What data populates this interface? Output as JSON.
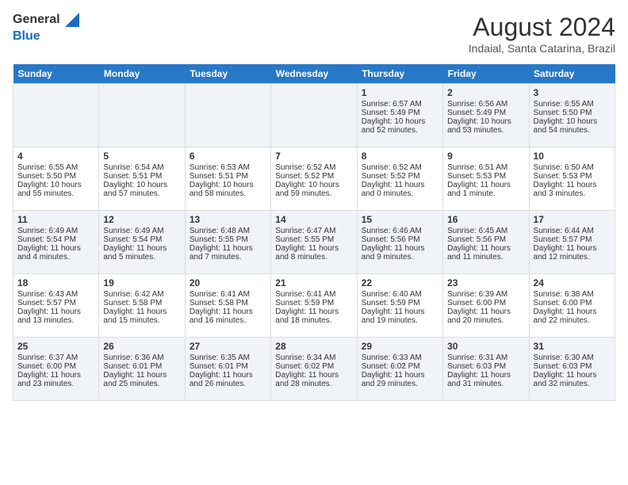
{
  "logo": {
    "general": "General",
    "blue": "Blue",
    "icon": "▶"
  },
  "title": "August 2024",
  "subtitle": "Indaial, Santa Catarina, Brazil",
  "headers": [
    "Sunday",
    "Monday",
    "Tuesday",
    "Wednesday",
    "Thursday",
    "Friday",
    "Saturday"
  ],
  "weeks": [
    [
      {
        "day": "",
        "sunrise": "",
        "sunset": "",
        "daylight": ""
      },
      {
        "day": "",
        "sunrise": "",
        "sunset": "",
        "daylight": ""
      },
      {
        "day": "",
        "sunrise": "",
        "sunset": "",
        "daylight": ""
      },
      {
        "day": "",
        "sunrise": "",
        "sunset": "",
        "daylight": ""
      },
      {
        "day": "1",
        "sunrise": "Sunrise: 6:57 AM",
        "sunset": "Sunset: 5:49 PM",
        "daylight": "Daylight: 10 hours and 52 minutes."
      },
      {
        "day": "2",
        "sunrise": "Sunrise: 6:56 AM",
        "sunset": "Sunset: 5:49 PM",
        "daylight": "Daylight: 10 hours and 53 minutes."
      },
      {
        "day": "3",
        "sunrise": "Sunrise: 6:55 AM",
        "sunset": "Sunset: 5:50 PM",
        "daylight": "Daylight: 10 hours and 54 minutes."
      }
    ],
    [
      {
        "day": "4",
        "sunrise": "Sunrise: 6:55 AM",
        "sunset": "Sunset: 5:50 PM",
        "daylight": "Daylight: 10 hours and 55 minutes."
      },
      {
        "day": "5",
        "sunrise": "Sunrise: 6:54 AM",
        "sunset": "Sunset: 5:51 PM",
        "daylight": "Daylight: 10 hours and 57 minutes."
      },
      {
        "day": "6",
        "sunrise": "Sunrise: 6:53 AM",
        "sunset": "Sunset: 5:51 PM",
        "daylight": "Daylight: 10 hours and 58 minutes."
      },
      {
        "day": "7",
        "sunrise": "Sunrise: 6:52 AM",
        "sunset": "Sunset: 5:52 PM",
        "daylight": "Daylight: 10 hours and 59 minutes."
      },
      {
        "day": "8",
        "sunrise": "Sunrise: 6:52 AM",
        "sunset": "Sunset: 5:52 PM",
        "daylight": "Daylight: 11 hours and 0 minutes."
      },
      {
        "day": "9",
        "sunrise": "Sunrise: 6:51 AM",
        "sunset": "Sunset: 5:53 PM",
        "daylight": "Daylight: 11 hours and 1 minute."
      },
      {
        "day": "10",
        "sunrise": "Sunrise: 6:50 AM",
        "sunset": "Sunset: 5:53 PM",
        "daylight": "Daylight: 11 hours and 3 minutes."
      }
    ],
    [
      {
        "day": "11",
        "sunrise": "Sunrise: 6:49 AM",
        "sunset": "Sunset: 5:54 PM",
        "daylight": "Daylight: 11 hours and 4 minutes."
      },
      {
        "day": "12",
        "sunrise": "Sunrise: 6:49 AM",
        "sunset": "Sunset: 5:54 PM",
        "daylight": "Daylight: 11 hours and 5 minutes."
      },
      {
        "day": "13",
        "sunrise": "Sunrise: 6:48 AM",
        "sunset": "Sunset: 5:55 PM",
        "daylight": "Daylight: 11 hours and 7 minutes."
      },
      {
        "day": "14",
        "sunrise": "Sunrise: 6:47 AM",
        "sunset": "Sunset: 5:55 PM",
        "daylight": "Daylight: 11 hours and 8 minutes."
      },
      {
        "day": "15",
        "sunrise": "Sunrise: 6:46 AM",
        "sunset": "Sunset: 5:56 PM",
        "daylight": "Daylight: 11 hours and 9 minutes."
      },
      {
        "day": "16",
        "sunrise": "Sunrise: 6:45 AM",
        "sunset": "Sunset: 5:56 PM",
        "daylight": "Daylight: 11 hours and 11 minutes."
      },
      {
        "day": "17",
        "sunrise": "Sunrise: 6:44 AM",
        "sunset": "Sunset: 5:57 PM",
        "daylight": "Daylight: 11 hours and 12 minutes."
      }
    ],
    [
      {
        "day": "18",
        "sunrise": "Sunrise: 6:43 AM",
        "sunset": "Sunset: 5:57 PM",
        "daylight": "Daylight: 11 hours and 13 minutes."
      },
      {
        "day": "19",
        "sunrise": "Sunrise: 6:42 AM",
        "sunset": "Sunset: 5:58 PM",
        "daylight": "Daylight: 11 hours and 15 minutes."
      },
      {
        "day": "20",
        "sunrise": "Sunrise: 6:41 AM",
        "sunset": "Sunset: 5:58 PM",
        "daylight": "Daylight: 11 hours and 16 minutes."
      },
      {
        "day": "21",
        "sunrise": "Sunrise: 6:41 AM",
        "sunset": "Sunset: 5:59 PM",
        "daylight": "Daylight: 11 hours and 18 minutes."
      },
      {
        "day": "22",
        "sunrise": "Sunrise: 6:40 AM",
        "sunset": "Sunset: 5:59 PM",
        "daylight": "Daylight: 11 hours and 19 minutes."
      },
      {
        "day": "23",
        "sunrise": "Sunrise: 6:39 AM",
        "sunset": "Sunset: 6:00 PM",
        "daylight": "Daylight: 11 hours and 20 minutes."
      },
      {
        "day": "24",
        "sunrise": "Sunrise: 6:38 AM",
        "sunset": "Sunset: 6:00 PM",
        "daylight": "Daylight: 11 hours and 22 minutes."
      }
    ],
    [
      {
        "day": "25",
        "sunrise": "Sunrise: 6:37 AM",
        "sunset": "Sunset: 6:00 PM",
        "daylight": "Daylight: 11 hours and 23 minutes."
      },
      {
        "day": "26",
        "sunrise": "Sunrise: 6:36 AM",
        "sunset": "Sunset: 6:01 PM",
        "daylight": "Daylight: 11 hours and 25 minutes."
      },
      {
        "day": "27",
        "sunrise": "Sunrise: 6:35 AM",
        "sunset": "Sunset: 6:01 PM",
        "daylight": "Daylight: 11 hours and 26 minutes."
      },
      {
        "day": "28",
        "sunrise": "Sunrise: 6:34 AM",
        "sunset": "Sunset: 6:02 PM",
        "daylight": "Daylight: 11 hours and 28 minutes."
      },
      {
        "day": "29",
        "sunrise": "Sunrise: 6:33 AM",
        "sunset": "Sunset: 6:02 PM",
        "daylight": "Daylight: 11 hours and 29 minutes."
      },
      {
        "day": "30",
        "sunrise": "Sunrise: 6:31 AM",
        "sunset": "Sunset: 6:03 PM",
        "daylight": "Daylight: 11 hours and 31 minutes."
      },
      {
        "day": "31",
        "sunrise": "Sunrise: 6:30 AM",
        "sunset": "Sunset: 6:03 PM",
        "daylight": "Daylight: 11 hours and 32 minutes."
      }
    ]
  ]
}
